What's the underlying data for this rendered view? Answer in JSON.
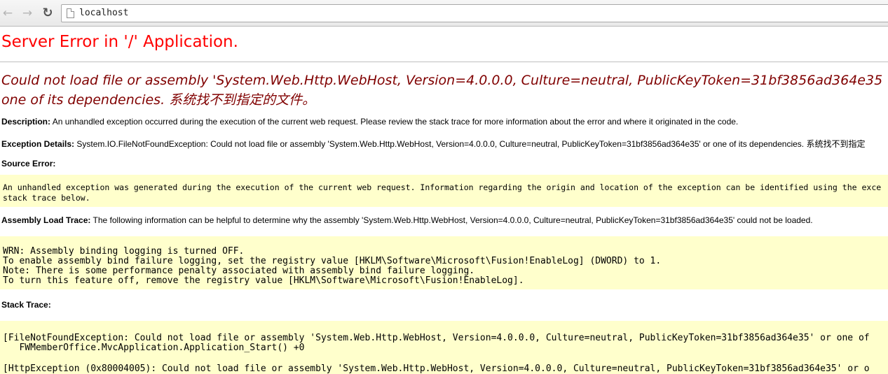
{
  "browser": {
    "back_icon": "←",
    "forward_icon": "→",
    "reload_icon": "↻",
    "address": "localhost"
  },
  "page": {
    "title": "Server Error in '/' Application.",
    "error_line_1": "Could not load file or assembly 'System.Web.Http.WebHost, Version=4.0.0.0, Culture=neutral, PublicKeyToken=31bf3856ad364e35",
    "error_line_2": "one of its dependencies. 系统找不到指定的文件。",
    "description_label": "Description:",
    "description_text": "An unhandled exception occurred during the execution of the current web request. Please review the stack trace for more information about the error and where it originated in the code.",
    "exception_label": "Exception Details:",
    "exception_text": "System.IO.FileNotFoundException: Could not load file or assembly 'System.Web.Http.WebHost, Version=4.0.0.0, Culture=neutral, PublicKeyToken=31bf3856ad364e35' or one of its dependencies. 系统找不到指定",
    "source_error_label": "Source Error:",
    "source_error_line_1": "An unhandled exception was generated during the execution of the current web request. Information regarding the origin and location of the exception can be identified using the exce",
    "source_error_line_2": "stack trace below.",
    "assembly_trace_label": "Assembly Load Trace:",
    "assembly_trace_text": "The following information can be helpful to determine why the assembly 'System.Web.Http.WebHost, Version=4.0.0.0, Culture=neutral, PublicKeyToken=31bf3856ad364e35' could not be loaded.",
    "assembly_trace_lines": [
      "WRN: Assembly binding logging is turned OFF.",
      "To enable assembly bind failure logging, set the registry value [HKLM\\Software\\Microsoft\\Fusion!EnableLog] (DWORD) to 1.",
      "Note: There is some performance penalty associated with assembly bind failure logging.",
      "To turn this feature off, remove the registry value [HKLM\\Software\\Microsoft\\Fusion!EnableLog]."
    ],
    "stack_trace_label": "Stack Trace:",
    "stack_trace_lines": [
      "[FileNotFoundException: Could not load file or assembly 'System.Web.Http.WebHost, Version=4.0.0.0, Culture=neutral, PublicKeyToken=31bf3856ad364e35' or one of",
      "   FWMemberOffice.MvcApplication.Application_Start() +0",
      "[HttpException (0x80004005): Could not load file or assembly 'System.Web.Http.WebHost, Version=4.0.0.0, Culture=neutral, PublicKeyToken=31bf3856ad364e35' or o"
    ]
  },
  "colors": {
    "title": "#ff0000",
    "heading": "#800000",
    "code_background": "#ffffcc"
  }
}
